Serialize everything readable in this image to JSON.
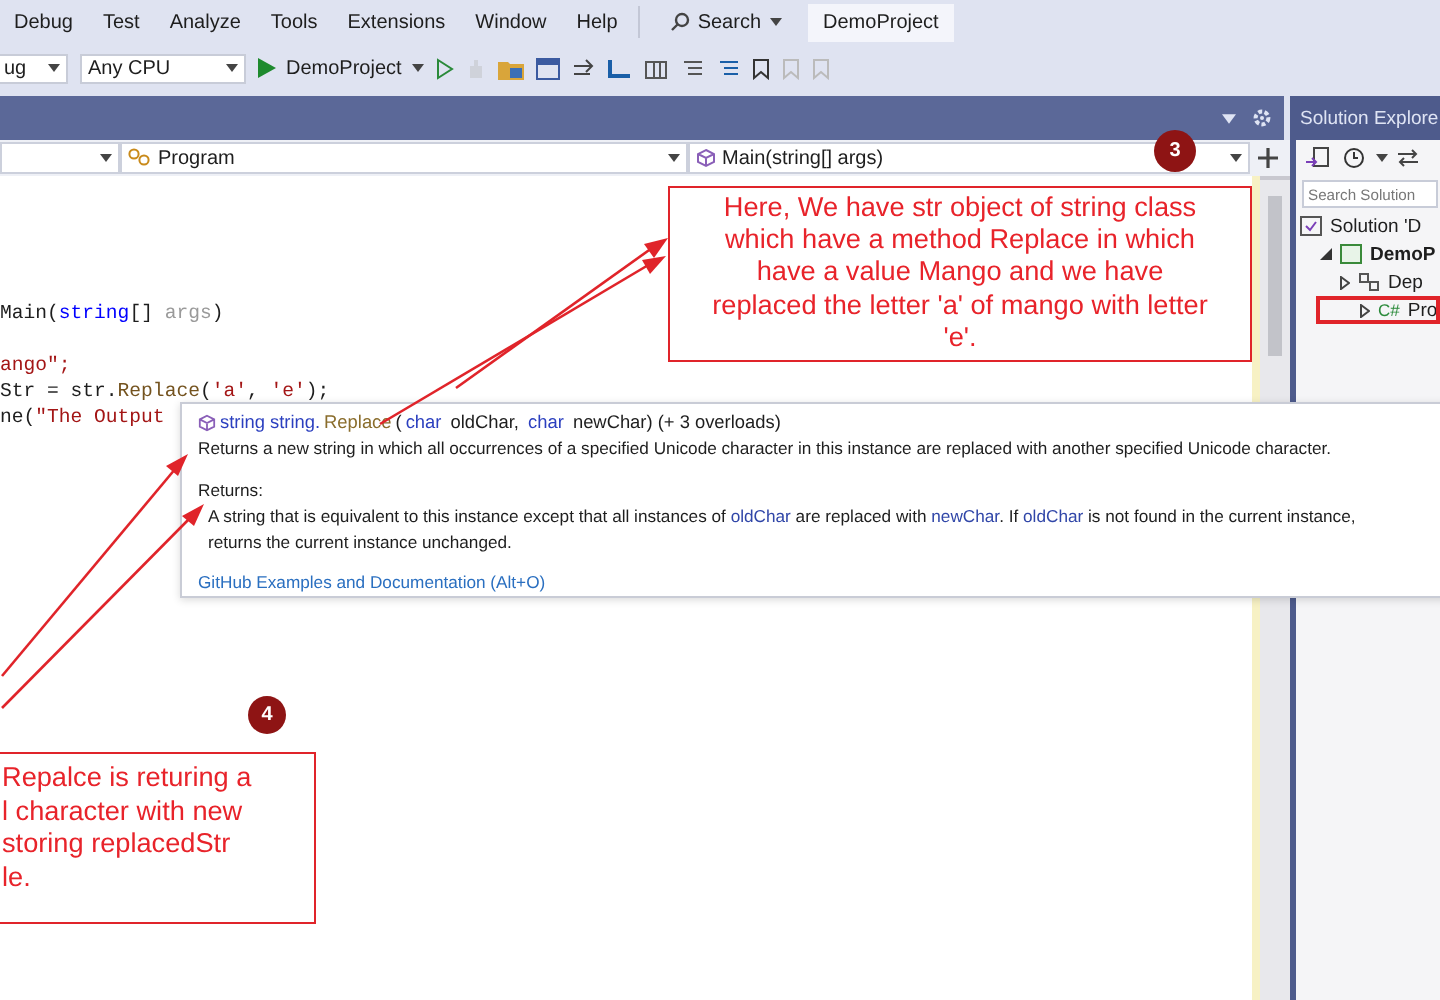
{
  "menu_bar": {
    "items": [
      "Debug",
      "Test",
      "Analyze",
      "Tools",
      "Extensions",
      "Window",
      "Help"
    ],
    "search": "Search",
    "project_title": "DemoProject"
  },
  "toolbar": {
    "configuration": "ug",
    "platform": "Any CPU",
    "start_target": "DemoProject"
  },
  "editor": {
    "nav_bar": {
      "type": "Program",
      "member": "Main(string[] args)"
    },
    "code_blocks": [
      {
        "lines": [
          {
            "tokens": [
              {
                "text": "Main(",
                "kind": "plain"
              },
              {
                "text": "string",
                "kind": "keyword"
              },
              {
                "text": "[] ",
                "kind": "plain"
              },
              {
                "text": "args",
                "kind": "unused"
              },
              {
                "text": ")",
                "kind": "plain"
              }
            ]
          }
        ]
      },
      {
        "lines": [
          {
            "tokens": [
              {
                "text": "ango\";",
                "kind": "string"
              }
            ]
          },
          {
            "tokens": [
              {
                "text": "Str = str.",
                "kind": "plain"
              },
              {
                "text": "Replace",
                "kind": "method"
              },
              {
                "text": "(",
                "kind": "plain"
              },
              {
                "text": "'a'",
                "kind": "string"
              },
              {
                "text": ", ",
                "kind": "plain"
              },
              {
                "text": "'e'",
                "kind": "string"
              },
              {
                "text": ");",
                "kind": "plain"
              }
            ]
          },
          {
            "tokens": [
              {
                "text": "ne(",
                "kind": "plain"
              },
              {
                "text": "\"The Output",
                "kind": "string"
              }
            ]
          }
        ]
      }
    ]
  },
  "tooltip": {
    "signature": [
      {
        "text": "string string.",
        "kind": "keyword"
      },
      {
        "text": "Replace",
        "kind": "method"
      },
      {
        "text": "(",
        "kind": "plain"
      },
      {
        "text": "char",
        "kind": "keyword"
      },
      {
        "text": " oldChar, ",
        "kind": "plain"
      },
      {
        "text": "char",
        "kind": "keyword"
      },
      {
        "text": " newChar) (+ 3 overloads)",
        "kind": "plain"
      }
    ],
    "description": "Returns a new string in which all occurrences of a specified Unicode character in this instance are replaced with another specified Unicode character.",
    "returns_label": "Returns:",
    "returns_lines": [
      [
        {
          "text": "A string that is equivalent to this instance except that all instances of ",
          "kind": "plain"
        },
        {
          "text": "oldChar",
          "kind": "param"
        },
        {
          "text": " are replaced with ",
          "kind": "plain"
        },
        {
          "text": "newChar",
          "kind": "param"
        },
        {
          "text": ". If ",
          "kind": "plain"
        },
        {
          "text": "oldChar",
          "kind": "param"
        },
        {
          "text": " is not found in the current instance,",
          "kind": "plain"
        }
      ],
      [
        {
          "text": "returns the current instance unchanged.",
          "kind": "plain"
        }
      ]
    ],
    "link": "GitHub Examples and Documentation (Alt+O)"
  },
  "callouts": [
    {
      "number": "3",
      "lines": [
        "Here, We have str object of string class",
        "which have a method Replace in which",
        "have a value Mango and we have",
        "replaced the letter 'a' of mango with letter",
        "'e'."
      ]
    },
    {
      "number": "4",
      "lines": [
        "Repalce is returing a",
        "l character with new",
        "storing replacedStr",
        "le."
      ]
    }
  ],
  "solution_explorer": {
    "title": "Solution Explore",
    "search_placeholder": "Search Solution",
    "tree": [
      {
        "label": "Solution 'D",
        "kind": "solution",
        "annotated": false,
        "children": [
          {
            "label": "DemoP",
            "kind": "project",
            "expanded": true,
            "annotated": false,
            "children": [
              {
                "label": "Dep",
                "kind": "dependencies",
                "expanded": false,
                "annotated": false
              },
              {
                "label": "Pro",
                "kind": "csharp",
                "type_label": "C#",
                "expanded": false,
                "annotated": true
              }
            ]
          }
        ]
      }
    ]
  }
}
